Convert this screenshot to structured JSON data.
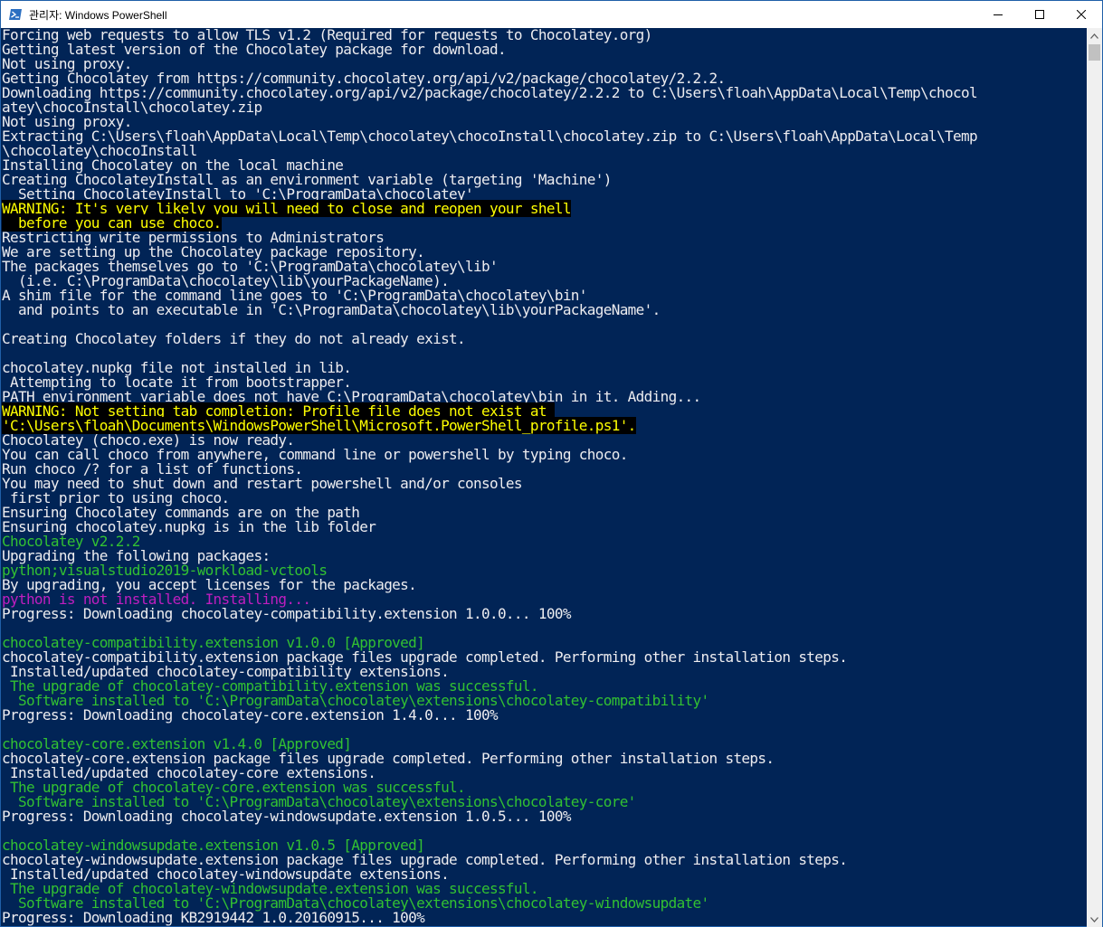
{
  "window": {
    "title": "관리자: Windows PowerShell",
    "icon": "powershell-icon",
    "controls": [
      "minimize-icon",
      "maximize-icon",
      "close-icon"
    ]
  },
  "colors": {
    "background": "#012456",
    "text": "#eeedf0",
    "warning": "#ffff00",
    "green": "#32c132",
    "magenta": "#c01ec0"
  },
  "console": {
    "lines": [
      "Forcing web requests to allow TLS v1.2 (Required for requests to Chocolatey.org)",
      "Getting latest version of the Chocolatey package for download.",
      "Not using proxy.",
      "Getting Chocolatey from https://community.chocolatey.org/api/v2/package/chocolatey/2.2.2.",
      "Downloading https://community.chocolatey.org/api/v2/package/chocolatey/2.2.2 to C:\\Users\\floah\\AppData\\Local\\Temp\\chocol",
      "atey\\chocoInstall\\chocolatey.zip",
      "Not using proxy.",
      "Extracting C:\\Users\\floah\\AppData\\Local\\Temp\\chocolatey\\chocoInstall\\chocolatey.zip to C:\\Users\\floah\\AppData\\Local\\Temp",
      "\\chocolatey\\chocoInstall",
      "Installing Chocolatey on the local machine",
      "Creating ChocolateyInstall as an environment variable (targeting 'Machine')",
      "  Setting ChocolateyInstall to 'C:\\ProgramData\\chocolatey'",
      "WARNING: It's very likely you will need to close and reopen your shell",
      "  before you can use choco.",
      "Restricting write permissions to Administrators",
      "We are setting up the Chocolatey package repository.",
      "The packages themselves go to 'C:\\ProgramData\\chocolatey\\lib'",
      "  (i.e. C:\\ProgramData\\chocolatey\\lib\\yourPackageName).",
      "A shim file for the command line goes to 'C:\\ProgramData\\chocolatey\\bin'",
      "  and points to an executable in 'C:\\ProgramData\\chocolatey\\lib\\yourPackageName'.",
      "",
      "Creating Chocolatey folders if they do not already exist.",
      "",
      "chocolatey.nupkg file not installed in lib.",
      " Attempting to locate it from bootstrapper.",
      "PATH environment variable does not have C:\\ProgramData\\chocolatey\\bin in it. Adding...",
      "WARNING: Not setting tab completion: Profile file does not exist at ",
      "'C:\\Users\\floah\\Documents\\WindowsPowerShell\\Microsoft.PowerShell_profile.ps1'.",
      "Chocolatey (choco.exe) is now ready.",
      "You can call choco from anywhere, command line or powershell by typing choco.",
      "Run choco /? for a list of functions.",
      "You may need to shut down and restart powershell and/or consoles",
      " first prior to using choco.",
      "Ensuring Chocolatey commands are on the path",
      "Ensuring chocolatey.nupkg is in the lib folder",
      "Chocolatey v2.2.2",
      "Upgrading the following packages:",
      "python;visualstudio2019-workload-vctools",
      "By upgrading, you accept licenses for the packages.",
      "python is not installed. Installing...",
      "Progress: Downloading chocolatey-compatibility.extension 1.0.0... 100%",
      "",
      "chocolatey-compatibility.extension v1.0.0 [Approved]",
      "chocolatey-compatibility.extension package files upgrade completed. Performing other installation steps.",
      " Installed/updated chocolatey-compatibility extensions.",
      " The upgrade of chocolatey-compatibility.extension was successful.",
      "  Software installed to 'C:\\ProgramData\\chocolatey\\extensions\\chocolatey-compatibility'",
      "Progress: Downloading chocolatey-core.extension 1.4.0... 100%",
      "",
      "chocolatey-core.extension v1.4.0 [Approved]",
      "chocolatey-core.extension package files upgrade completed. Performing other installation steps.",
      " Installed/updated chocolatey-core extensions.",
      " The upgrade of chocolatey-core.extension was successful.",
      "  Software installed to 'C:\\ProgramData\\chocolatey\\extensions\\chocolatey-core'",
      "Progress: Downloading chocolatey-windowsupdate.extension 1.0.5... 100%",
      "",
      "chocolatey-windowsupdate.extension v1.0.5 [Approved]",
      "chocolatey-windowsupdate.extension package files upgrade completed. Performing other installation steps.",
      " Installed/updated chocolatey-windowsupdate extensions.",
      " The upgrade of chocolatey-windowsupdate.extension was successful.",
      "  Software installed to 'C:\\ProgramData\\chocolatey\\extensions\\chocolatey-windowsupdate'",
      "Progress: Downloading KB2919442 1.0.20160915... 100%"
    ],
    "line_styles": [
      "",
      "",
      "",
      "",
      "",
      "",
      "",
      "",
      "",
      "",
      "",
      "",
      "warn",
      "warn",
      "",
      "",
      "",
      "",
      "",
      "",
      "",
      "",
      "",
      "",
      "",
      "",
      "warn",
      "warn",
      "",
      "",
      "",
      "",
      "",
      "",
      "",
      "green",
      "",
      "green",
      "",
      "magenta",
      "",
      "",
      "green",
      "",
      "",
      "green",
      "green",
      "",
      "",
      "green",
      "",
      "",
      "green",
      "green",
      "",
      "",
      "green",
      "",
      "",
      "green",
      "green",
      ""
    ]
  }
}
